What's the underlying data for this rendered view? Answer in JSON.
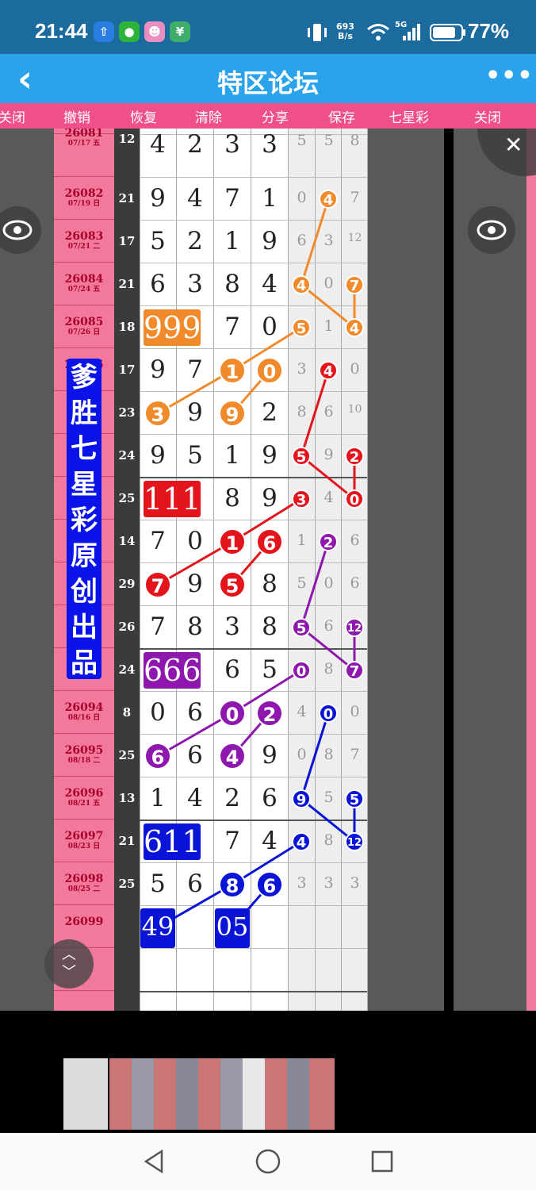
{
  "status_bar": {
    "time": "21:44",
    "net_speed_value": "693",
    "net_speed_unit": "B/s",
    "signal_label": "5G",
    "battery": "77%",
    "app_icons": [
      "upload-icon",
      "wechat-icon",
      "game-icon",
      "finance-app-icon"
    ]
  },
  "app_bar": {
    "title": "特区论坛"
  },
  "toolbar": {
    "left_close": "关闭",
    "undo": "撤销",
    "restore": "恢复",
    "clear": "清除",
    "share": "分享",
    "save": "保存",
    "lottery": "七星彩",
    "right_close": "关闭"
  },
  "periods": [
    {
      "no": "26081",
      "date": "07/17 五"
    },
    {
      "no": "26082",
      "date": "07/19 日"
    },
    {
      "no": "26083",
      "date": "07/21 二"
    },
    {
      "no": "26084",
      "date": "07/24 五"
    },
    {
      "no": "26085",
      "date": "07/26 日"
    },
    {
      "no": "26086",
      "date": ""
    },
    {
      "no": "26094",
      "date": "08/16 日"
    },
    {
      "no": "26095",
      "date": "08/18 二"
    },
    {
      "no": "26096",
      "date": "08/21 五"
    },
    {
      "no": "26097",
      "date": "08/23 日"
    },
    {
      "no": "26098",
      "date": "08/25 二"
    },
    {
      "no": "26099",
      "date": ""
    }
  ],
  "sums": [
    "12",
    "21",
    "17",
    "21",
    "18",
    "17",
    "23",
    "24",
    "25",
    "14",
    "29",
    "26",
    "24",
    "8",
    "25",
    "13",
    "21",
    "25"
  ],
  "rows": [
    [
      "4",
      "2",
      "3",
      "3"
    ],
    [
      "9",
      "4",
      "7",
      "1"
    ],
    [
      "5",
      "2",
      "1",
      "9"
    ],
    [
      "6",
      "3",
      "8",
      "4"
    ],
    [
      "",
      "",
      "7",
      "0"
    ],
    [
      "9",
      "7",
      "1",
      "0"
    ],
    [
      "3",
      "9",
      "9",
      "2"
    ],
    [
      "9",
      "5",
      "1",
      "9"
    ],
    [
      "",
      "",
      "8",
      "9"
    ],
    [
      "7",
      "0",
      "1",
      "6"
    ],
    [
      "7",
      "9",
      "5",
      "8"
    ],
    [
      "7",
      "8",
      "3",
      "8"
    ],
    [
      "",
      "",
      "6",
      "5"
    ],
    [
      "0",
      "6",
      "0",
      "2"
    ],
    [
      "6",
      "6",
      "4",
      "9"
    ],
    [
      "1",
      "4",
      "2",
      "6"
    ],
    [
      "",
      "",
      "7",
      "4"
    ],
    [
      "5",
      "6",
      "8",
      "6"
    ]
  ],
  "small": [
    [
      "5",
      "5",
      "8"
    ],
    [
      "0",
      "4",
      "7"
    ],
    [
      "6",
      "3",
      "12"
    ],
    [
      "4",
      "0",
      "7"
    ],
    [
      "5",
      "1",
      "4"
    ],
    [
      "3",
      "4",
      "0"
    ],
    [
      "8",
      "6",
      "10"
    ],
    [
      "5",
      "9",
      "2"
    ],
    [
      "3",
      "4",
      "0"
    ],
    [
      "1",
      "2",
      "6"
    ],
    [
      "5",
      "0",
      "6"
    ],
    [
      "5",
      "6",
      "12"
    ],
    [
      "0",
      "8",
      "7"
    ],
    [
      "4",
      "0",
      "0"
    ],
    [
      "0",
      "8",
      "7"
    ],
    [
      "9",
      "5",
      "5"
    ],
    [
      "4",
      "8",
      "12"
    ],
    [
      "3",
      "3",
      "3"
    ]
  ],
  "highlights": {
    "orange": "999",
    "red": "111",
    "purple": "666",
    "blue": "611",
    "pred1": "49",
    "pred2": "05"
  },
  "banner": "爹胜七星彩原创出品",
  "colors": {
    "orange": "#f08a2a",
    "red": "#e3141c",
    "purple": "#8e17ad",
    "blue": "#0a14d6"
  }
}
